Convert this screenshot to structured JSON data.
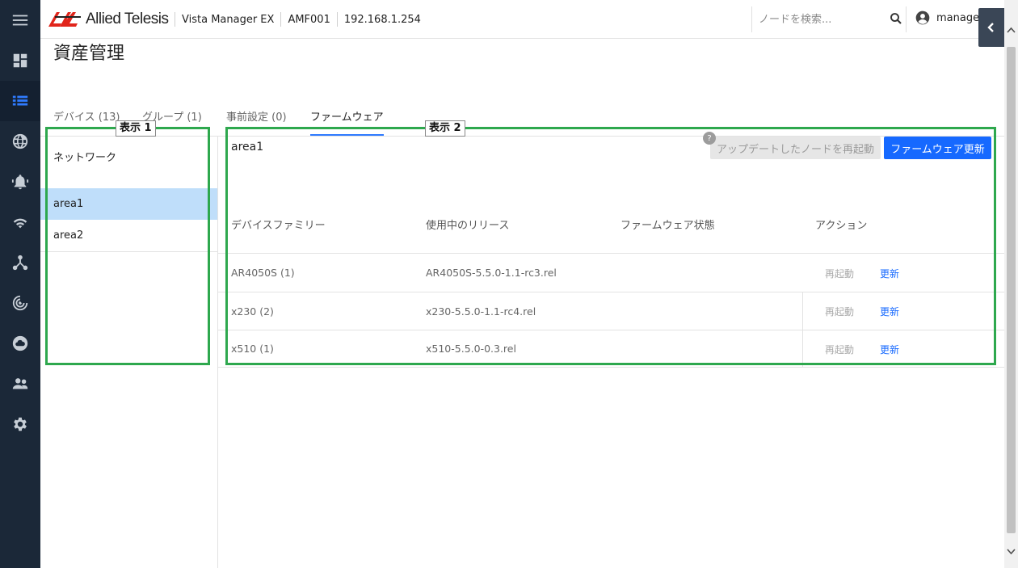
{
  "rail": {
    "items": [
      {
        "icon": "menu-icon"
      },
      {
        "icon": "dashboard-icon"
      },
      {
        "icon": "asset-list-icon",
        "active": true
      },
      {
        "icon": "globe-icon"
      },
      {
        "icon": "alarm-bell-icon"
      },
      {
        "icon": "wireless-icon"
      },
      {
        "icon": "network-topology-icon"
      },
      {
        "icon": "radar-icon"
      },
      {
        "icon": "cloud-icon"
      },
      {
        "icon": "users-icon"
      },
      {
        "icon": "settings-gear-icon"
      }
    ]
  },
  "header": {
    "brand": "Allied Telesis",
    "product": "Vista Manager EX",
    "amf": "AMF001",
    "ip": "192.168.1.254",
    "search_placeholder": "ノードを検索...",
    "user": "manager"
  },
  "page": {
    "title": "資産管理"
  },
  "tabs_left": [
    {
      "label": "デバイス (13)"
    },
    {
      "label": "グループ (1)"
    }
  ],
  "tabs_right": [
    {
      "label": "事前設定 (0)"
    },
    {
      "label": "ファームウェア",
      "active": true
    }
  ],
  "left_panel": {
    "heading": "ネットワーク",
    "items": [
      {
        "label": "area1",
        "selected": true
      },
      {
        "label": "area2"
      }
    ]
  },
  "right_panel": {
    "title": "area1",
    "restart_button": "アップデートしたノードを再起動",
    "update_button": "ファームウェア更新",
    "columns": [
      "デバイスファミリー",
      "使用中のリリース",
      "ファームウェア状態",
      "アクション"
    ],
    "rows": [
      {
        "family": "AR4050S (1)",
        "release": "AR4050S-5.5.0-1.1-rc3.rel",
        "status": "",
        "restart": "再起動",
        "update": "更新"
      },
      {
        "family": "x230 (2)",
        "release": "x230-5.5.0-1.1-rc4.rel",
        "status": "",
        "restart": "再起動",
        "update": "更新"
      },
      {
        "family": "x510 (1)",
        "release": "x510-5.5.0-0.3.rel",
        "status": "",
        "restart": "再起動",
        "update": "更新"
      }
    ]
  },
  "annotations": {
    "box1": "表示 1",
    "box2": "表示 2"
  },
  "colors": {
    "rail_bg": "#1b2838",
    "accent": "#1669ff",
    "selected_row": "#bfdefa",
    "annotation": "#2ea84e"
  }
}
